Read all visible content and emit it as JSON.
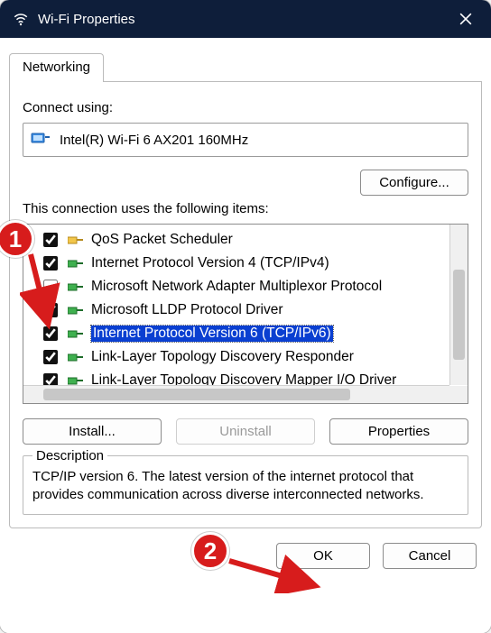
{
  "window": {
    "title": "Wi-Fi Properties",
    "icon_name": "wifi-icon"
  },
  "tabs": {
    "networking": "Networking"
  },
  "connect_using_label": "Connect using:",
  "adapter": {
    "name": "Intel(R) Wi-Fi 6 AX201 160MHz"
  },
  "configure_label": "Configure...",
  "items_label": "This connection uses the following items:",
  "items": [
    {
      "label": "QoS Packet Scheduler",
      "checked": true,
      "icon": "net-svc-yellow"
    },
    {
      "label": "Internet Protocol Version 4 (TCP/IPv4)",
      "checked": true,
      "icon": "net-proto-green"
    },
    {
      "label": "Microsoft Network Adapter Multiplexor Protocol",
      "checked": false,
      "icon": "net-proto-green"
    },
    {
      "label": "Microsoft LLDP Protocol Driver",
      "checked": true,
      "icon": "net-proto-green"
    },
    {
      "label": "Internet Protocol Version 6 (TCP/IPv6)",
      "checked": true,
      "icon": "net-proto-green",
      "selected": true
    },
    {
      "label": "Link-Layer Topology Discovery Responder",
      "checked": true,
      "icon": "net-proto-green"
    },
    {
      "label": "Link-Layer Topology Discovery Mapper I/O Driver",
      "checked": true,
      "icon": "net-proto-green"
    }
  ],
  "buttons": {
    "install": "Install...",
    "uninstall": "Uninstall",
    "properties": "Properties"
  },
  "description": {
    "legend": "Description",
    "text": "TCP/IP version 6. The latest version of the internet protocol that provides communication across diverse interconnected networks."
  },
  "footer": {
    "ok": "OK",
    "cancel": "Cancel"
  },
  "annotations": {
    "badge1": "1",
    "badge2": "2"
  }
}
